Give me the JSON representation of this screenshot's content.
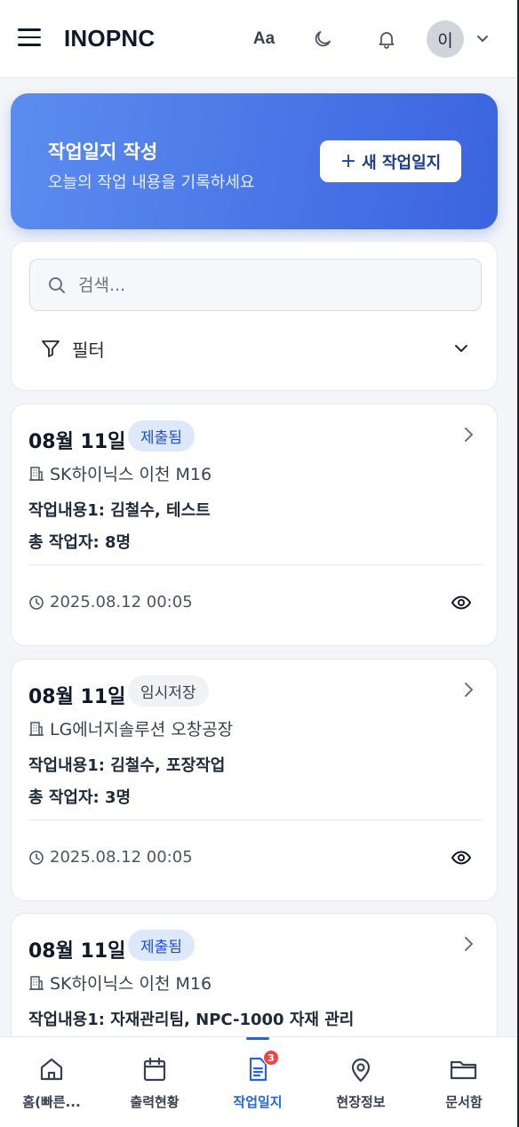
{
  "header": {
    "logo": "INOPNC",
    "font_toggle": "Aa",
    "avatar_initial": "이"
  },
  "hero": {
    "title": "작업일지 작성",
    "subtitle": "오늘의 작업 내용을 기록하세요",
    "button_plus": "+",
    "button_label": "새 작업일지"
  },
  "search": {
    "placeholder": "검색...",
    "value": "",
    "filter_label": "필터"
  },
  "reports": [
    {
      "date": "08월 11일",
      "status": "제출됨",
      "site": "SK하이닉스 이천 M16",
      "line1": "작업내용1: 김철수, 테스트",
      "line2": "총 작업자: 8명",
      "timestamp": "2025.08.12 00:05"
    },
    {
      "date": "08월 11일",
      "status": "임시저장",
      "site": "LG에너지솔루션 오창공장",
      "line1": "작업내용1: 김철수, 포장작업",
      "line2": "총 작업자: 3명",
      "timestamp": "2025.08.12 00:05"
    },
    {
      "date": "08월 11일",
      "status": "제출됨",
      "site": "SK하이닉스 이천 M16",
      "line1": "작업내용1: 자재관리팀, NPC-1000 자재 관리",
      "line2": "",
      "timestamp": ""
    }
  ],
  "bottom_nav": {
    "items": [
      {
        "label": "홈(빠른...",
        "icon": "home-icon"
      },
      {
        "label": "출력현황",
        "icon": "calendar-icon"
      },
      {
        "label": "작업일지",
        "icon": "document-icon",
        "badge": "3",
        "active": true
      },
      {
        "label": "현장정보",
        "icon": "map-pin-icon"
      },
      {
        "label": "문서함",
        "icon": "folder-icon"
      }
    ]
  },
  "colors": {
    "accent": "#2563eb",
    "hero_gradient_start": "#5b8def",
    "hero_gradient_end": "#3b63e0",
    "badge_submitted_bg": "#dde8fb",
    "badge_draft_bg": "#f1f2f4",
    "notification_badge": "#ef4444"
  }
}
